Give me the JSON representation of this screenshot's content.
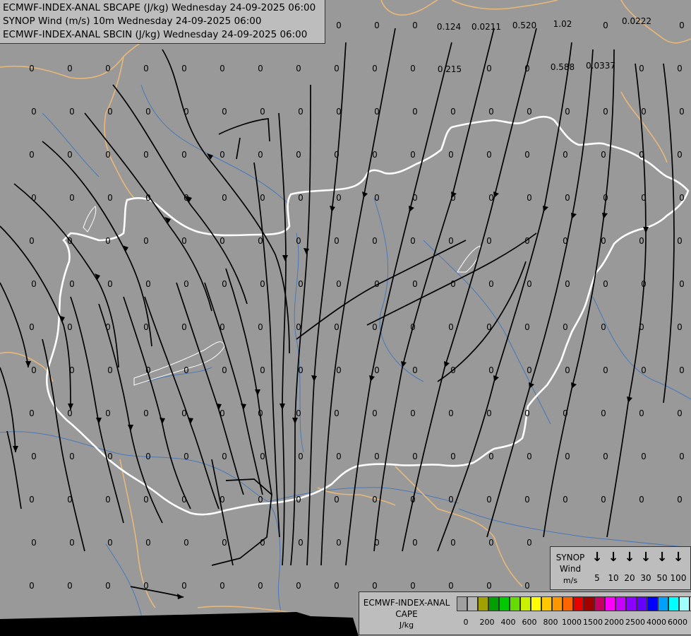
{
  "header": {
    "line1": "ECMWF-INDEX-ANAL SBCAPE (J/kg) Wednesday 24-09-2025 06:00",
    "line2": "SYNOP Wind (m/s) 10m Wednesday 24-09-2025 06:00",
    "line3": "ECMWF-INDEX-ANAL SBCIN (J/kg) Wednesday 24-09-2025 06:00"
  },
  "map_values": {
    "nonzero": [
      "0.124",
      "0.0211",
      "0.520",
      "1.02",
      "0.0222",
      "0.215",
      "0.588",
      "0.0337"
    ],
    "zero_label": "0"
  },
  "wind_legend": {
    "title1": "SYNOP",
    "title2": "Wind",
    "unit": "m/s",
    "speeds": [
      "5",
      "10",
      "20",
      "30",
      "50",
      "100"
    ]
  },
  "cape_legend": {
    "title1": "ECMWF-INDEX-ANAL",
    "title2": "CAPE",
    "unit": "J/kg",
    "colors": [
      "#a0a0a0",
      "#b4b4b4",
      "#a0a000",
      "#00a000",
      "#00c800",
      "#64dc00",
      "#c8f000",
      "#ffff00",
      "#ffc800",
      "#ff9600",
      "#ff6400",
      "#e60000",
      "#a00000",
      "#c80064",
      "#ff00ff",
      "#c800ff",
      "#8c00ff",
      "#6400ff",
      "#0000ff",
      "#00a0ff",
      "#00ffff",
      "#a0ffff",
      "#ffffff"
    ],
    "ticks": [
      "0",
      "200",
      "400",
      "600",
      "800",
      "1000",
      "1500",
      "2000",
      "2500",
      "4000",
      "6000"
    ]
  },
  "colors": {
    "background": "#999999",
    "border": "#ffffff",
    "neighbor_border": "#e8b878",
    "river": "#4a78b8",
    "streamline": "#000000"
  }
}
